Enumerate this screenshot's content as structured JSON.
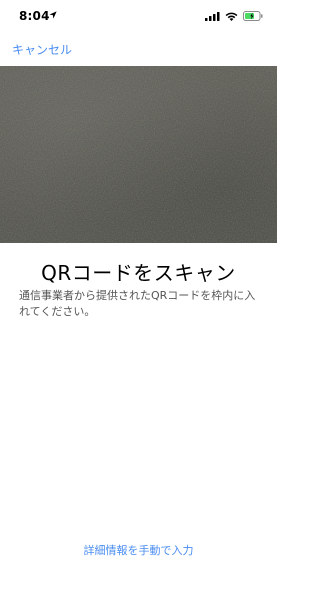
{
  "status_bar": {
    "time": "8:04",
    "icons": [
      "location-arrow-icon",
      "cellular-signal-icon",
      "wifi-icon",
      "battery-icon"
    ]
  },
  "nav": {
    "cancel_label": "キャンセル"
  },
  "main": {
    "title": "QRコードをスキャン",
    "description": "通信事業者から提供されたQRコードを枠内に入れてください。"
  },
  "footer": {
    "manual_entry_label": "詳細情報を手動で入力"
  },
  "colors": {
    "accent": "#4a8df0",
    "camera_bg": "#55554d"
  }
}
